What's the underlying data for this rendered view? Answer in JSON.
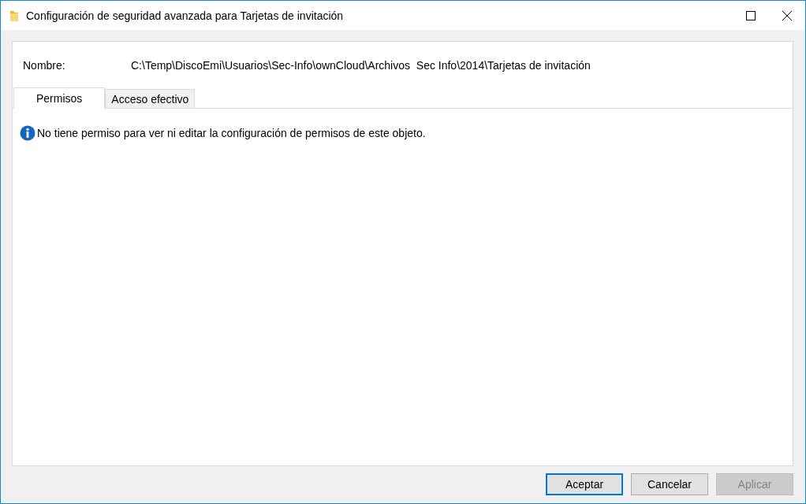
{
  "window": {
    "title": "Configuración de seguridad avanzada para Tarjetas de invitación"
  },
  "name_field": {
    "label": "Nombre:",
    "value": "C:\\Temp\\DiscoEmi\\Usuarios\\Sec-Info\\ownCloud\\Archivos  Sec Info\\2014\\Tarjetas de invitación"
  },
  "tabs": [
    {
      "label": "Permisos",
      "selected": true
    },
    {
      "label": "Acceso efectivo",
      "selected": false
    }
  ],
  "message": "No tiene permiso para ver ni editar la configuración de permisos de este objeto.",
  "buttons": [
    {
      "label": "Aceptar",
      "default": true,
      "disabled": false
    },
    {
      "label": "Cancelar",
      "default": false,
      "disabled": false
    },
    {
      "label": "Aplicar",
      "default": false,
      "disabled": true
    }
  ]
}
